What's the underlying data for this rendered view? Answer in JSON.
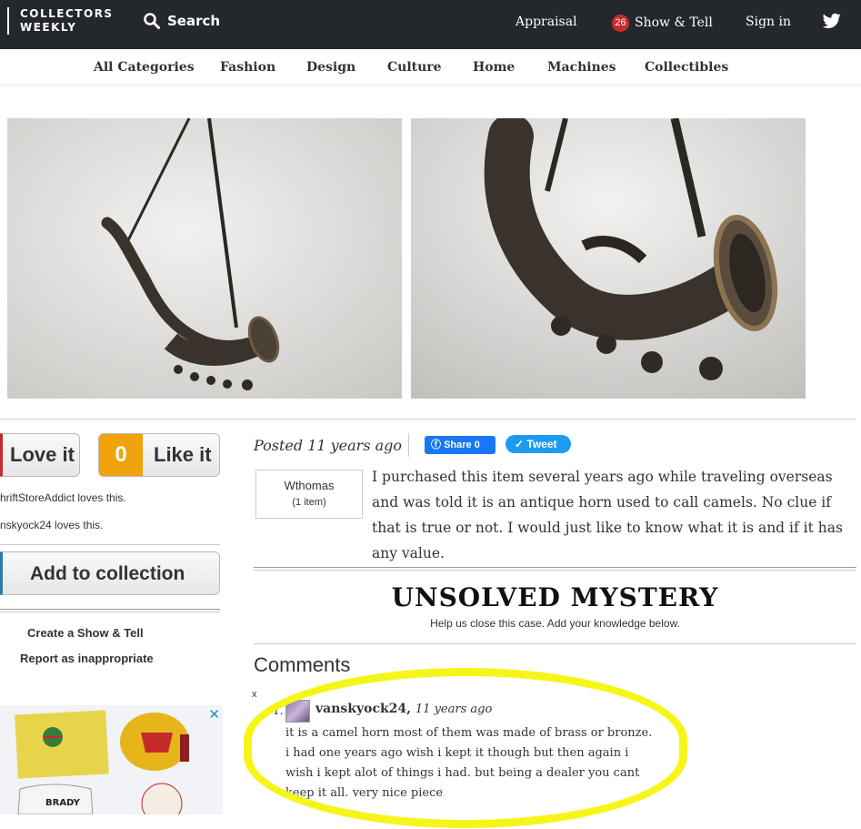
{
  "header": {
    "logo_line1": "COLLECTORS",
    "logo_line2": "WEEKLY",
    "search_label": "Search",
    "appraisal": "Appraisal",
    "show_tell_badge": "26",
    "show_tell": "Show & Tell",
    "sign_in": "Sign in"
  },
  "categories": [
    "All Categories",
    "Fashion",
    "Design",
    "Culture",
    "Home",
    "Machines",
    "Collectibles"
  ],
  "actions": {
    "love_label": "Love it",
    "like_count": "0",
    "like_label": "Like it",
    "lovers": [
      "hriftStoreAddict loves this.",
      "nskyock24 loves this."
    ],
    "add_collection": "Add to collection",
    "create_show_tell": "Create a Show & Tell",
    "report": "Report as inappropriate"
  },
  "post": {
    "posted": "Posted 11 years ago",
    "share_label": "Share 0",
    "tweet_label": "Tweet",
    "username": "Wthomas",
    "item_count": "(1 item)",
    "description": "I purchased this item several years ago while traveling overseas and was told it is an antique horn used to call camels. No clue if that is true or not. I would just like to know what it is and if it has any value."
  },
  "mystery": {
    "title": "UNSOLVED MYSTERY",
    "subtitle": "Help us close this case. Add your knowledge below."
  },
  "comments": {
    "heading": "Comments",
    "close_mark": "x",
    "items": [
      {
        "number": "1.",
        "author": "vanskyock24,",
        "time": "11 years ago",
        "text": "it is a camel horn most of them was made of brass or bronze. i had one years ago wish i kept it though but then again i wish i kept alot of things i had. but being a dealer you cant keep it all. very nice piece"
      }
    ]
  },
  "ad": {
    "close": "✕",
    "jersey_text": "BRADY"
  },
  "colors": {
    "topbar": "#24272c",
    "badge": "#c62b2b",
    "like_orange": "#f0a30a",
    "facebook": "#1877f2",
    "twitter": "#1d9bf0",
    "highlight": "#f5f51a"
  }
}
